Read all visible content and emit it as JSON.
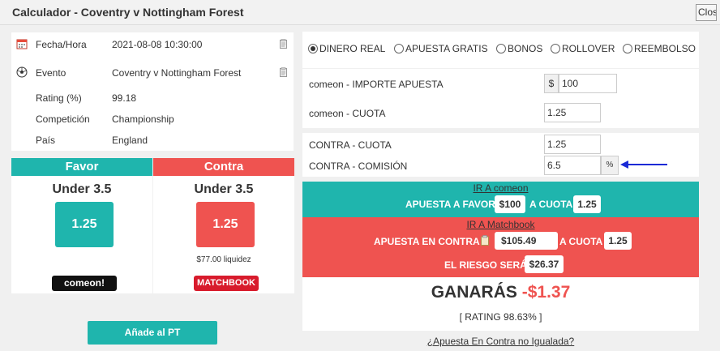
{
  "window": {
    "title": "Calculador - Coventry v Nottingham Forest",
    "close_label": "Close"
  },
  "info": {
    "rows": [
      {
        "label": "Fecha/Hora",
        "value": "2021-08-08 10:30:00",
        "icon": "calendar-icon",
        "copy": true
      },
      {
        "label": "Evento",
        "value": "Coventry v Nottingham Forest",
        "icon": "soccer-ball-icon",
        "copy": true
      },
      {
        "label": "Rating (%)",
        "value": "99.18"
      },
      {
        "label": "Competición",
        "value": "Championship"
      },
      {
        "label": "País",
        "value": "England"
      }
    ]
  },
  "favor": {
    "header": "Favor",
    "market": "Under 3.5",
    "odds": "1.25",
    "bookmaker": "comeon!",
    "color": "#1fb5ad"
  },
  "contra": {
    "header": "Contra",
    "market": "Under 3.5",
    "odds": "1.25",
    "liquidity": "$77.00 liquidez",
    "exchange": "MATCHBOOK",
    "color": "#ef5350"
  },
  "add_button": "Añade al PT",
  "bet_types": [
    {
      "label": "DINERO REAL",
      "selected": true
    },
    {
      "label": "APUESTA GRATIS",
      "selected": false
    },
    {
      "label": "BONOS",
      "selected": false
    },
    {
      "label": "ROLLOVER",
      "selected": false
    },
    {
      "label": "REEMBOLSO",
      "selected": false
    }
  ],
  "back_fields": {
    "stake_label": "comeon - IMPORTE APUESTA",
    "currency": "$",
    "stake_value": "100",
    "odds_label": "comeon - CUOTA",
    "odds_value": "1.25"
  },
  "lay_fields": {
    "odds_label": "CONTRA - CUOTA",
    "odds_value": "1.25",
    "commission_label": "CONTRA - COMISIÓN",
    "commission_value": "6.5",
    "commission_unit": "%"
  },
  "back_section": {
    "link": "IR A comeon",
    "stake_text": "APUESTA A FAVOR",
    "stake": "$100",
    "odds_text": "A CUOTA",
    "odds": "1.25"
  },
  "lay_section": {
    "link": "IR A Matchbook",
    "stake_text": "APUESTA EN CONTRA",
    "stake": "$105.49",
    "odds_text": "A CUOTA",
    "odds": "1.25",
    "risk_text": "EL RIESGO SERÁ",
    "risk": "$26.37"
  },
  "result": {
    "label": "GANARÁS",
    "amount": "-$1.37",
    "rating": "[ RATING 98.63% ]"
  },
  "unmatched_link": "¿Apuesta En Contra no Igualada?",
  "colors": {
    "teal": "#1fb5ad",
    "red": "#ef5350",
    "arrow": "#1a2ad6"
  }
}
